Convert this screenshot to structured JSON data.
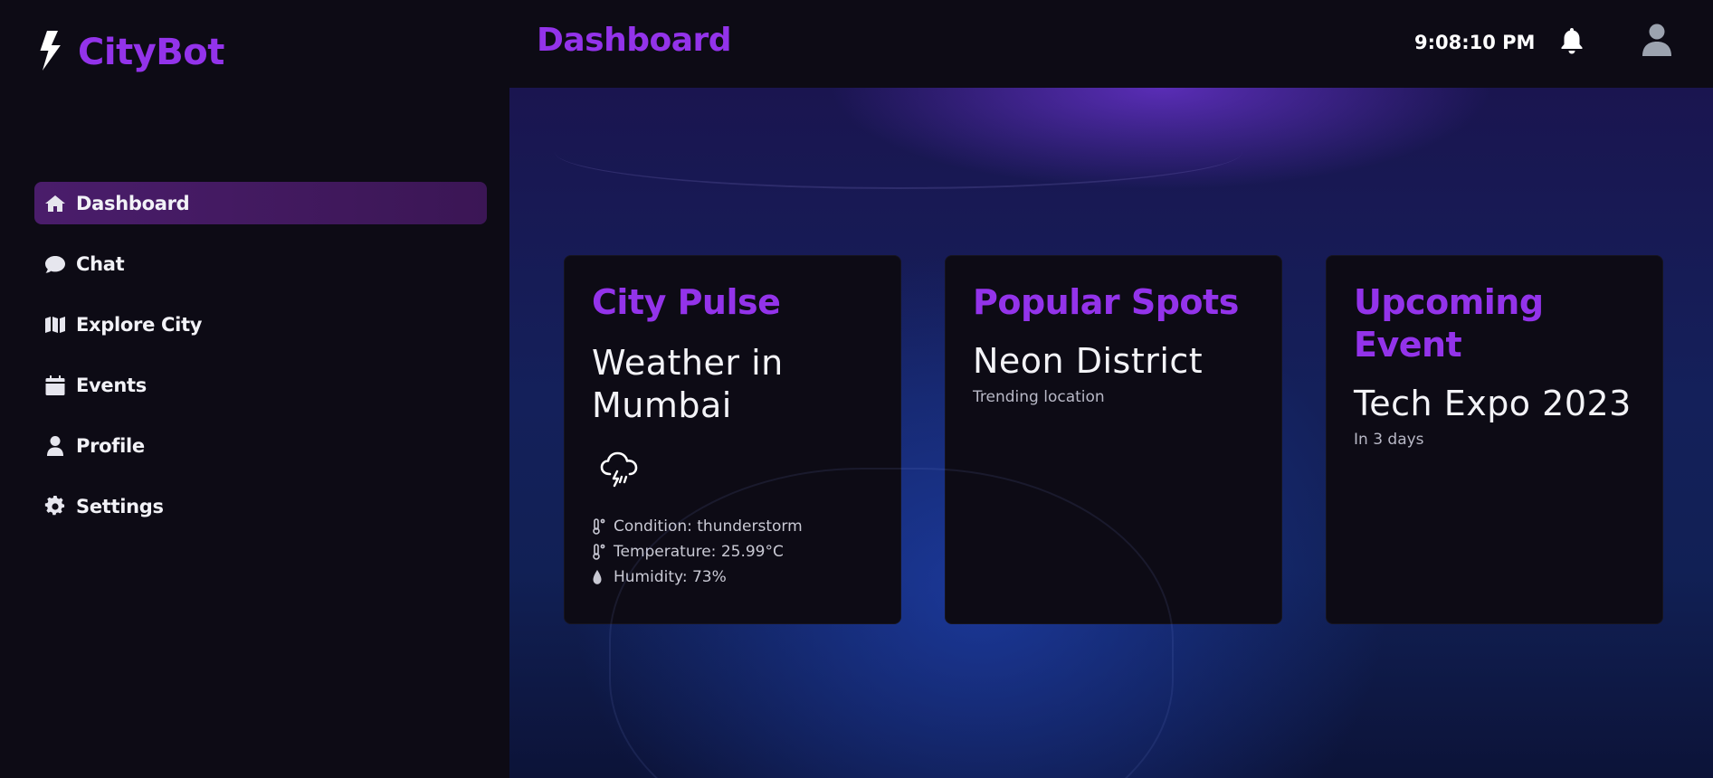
{
  "app": {
    "name": "CityBot"
  },
  "header": {
    "title": "Dashboard",
    "time": "9:08:10 PM"
  },
  "sidebar": {
    "items": [
      {
        "label": "Dashboard",
        "icon": "home-icon",
        "active": true
      },
      {
        "label": "Chat",
        "icon": "chat-icon",
        "active": false
      },
      {
        "label": "Explore City",
        "icon": "map-icon",
        "active": false
      },
      {
        "label": "Events",
        "icon": "calendar-icon",
        "active": false
      },
      {
        "label": "Profile",
        "icon": "user-icon",
        "active": false
      },
      {
        "label": "Settings",
        "icon": "gear-icon",
        "active": false
      }
    ]
  },
  "cards": {
    "pulse": {
      "title": "City Pulse",
      "headline": "Weather in Mumbai",
      "icon": "thunderstorm-icon",
      "condition": "Condition: thunderstorm",
      "temperature": "Temperature: 25.99°C",
      "humidity": "Humidity: 73%"
    },
    "spots": {
      "title": "Popular Spots",
      "headline": "Neon District",
      "sub": "Trending location"
    },
    "event": {
      "title": "Upcoming Event",
      "headline": "Tech Expo 2023",
      "sub": "In 3 days"
    }
  },
  "colors": {
    "accent": "#9333ea",
    "background": "#0d0b15",
    "active_nav": "#4a1d6b"
  }
}
